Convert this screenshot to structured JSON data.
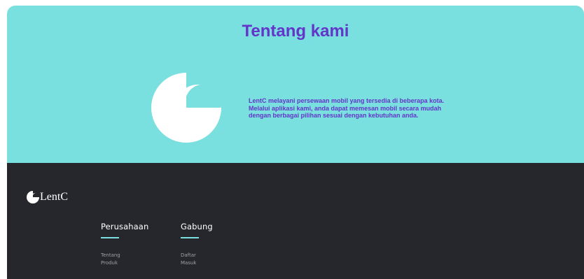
{
  "about": {
    "title": "Tentang kami",
    "description_lines": [
      "LentC melayani persewaan mobil yang tersedia di beberapa kota.",
      "Melalui aplikasi kami, anda dapat memesan mobil secara mudah",
      "dengan berbagai pilihan sesuai dengan kebutuhan anda."
    ],
    "logo_icon": "moon-logo-icon"
  },
  "footer": {
    "brand": "LentC",
    "brand_icon": "moon-logo-icon",
    "columns": [
      {
        "title": "Perusahaan",
        "links": [
          "Tentang",
          "Produk"
        ]
      },
      {
        "title": "Gabung",
        "links": [
          "Daftar",
          "Masuk"
        ]
      }
    ]
  },
  "colors": {
    "about_bg": "#79dfdf",
    "accent_text": "#6336c9",
    "footer_bg": "#26272c",
    "underline": "#79dfdf"
  }
}
